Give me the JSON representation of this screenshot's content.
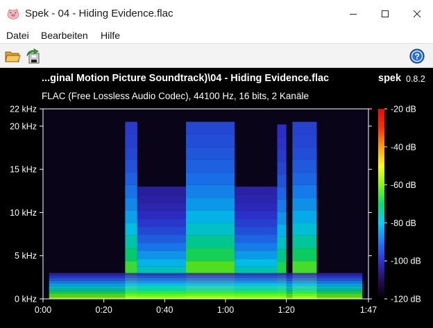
{
  "window": {
    "title": "Spek - 04 - Hiding Evidence.flac",
    "app_icon": "pig-icon"
  },
  "menu": {
    "items": [
      "Datei",
      "Bearbeiten",
      "Hilfe"
    ]
  },
  "toolbar": {
    "open_icon": "folder-open-icon",
    "save_icon": "save-export-icon",
    "help_icon": "help-icon"
  },
  "spectrogram": {
    "file_title": "...ginal Motion Picture Soundtrack)\\04 - Hiding Evidence.flac",
    "app_name": "spek",
    "version": "0.8.2",
    "file_info": "FLAC (Free Lossless Audio Codec), 44100 Hz, 16 bits, 2 Kanäle"
  },
  "chart_data": {
    "type": "heatmap",
    "title": "...ginal Motion Picture Soundtrack)\\04 - Hiding Evidence.flac",
    "subtitle": "FLAC (Free Lossless Audio Codec), 44100 Hz, 16 bits, 2 Kanäle",
    "x_ticks": [
      "0:00",
      "0:20",
      "0:40",
      "1:00",
      "1:20",
      "1:47"
    ],
    "x_tick_seconds": [
      0,
      20,
      40,
      60,
      80,
      107
    ],
    "x_range": [
      0,
      107
    ],
    "y_ticks": [
      "0 kHz",
      "5 kHz",
      "10 kHz",
      "15 kHz",
      "20 kHz",
      "22 kHz"
    ],
    "y_tick_khz": [
      0,
      5,
      10,
      15,
      20,
      22
    ],
    "y_range": [
      0,
      22
    ],
    "colorbar_ticks": [
      "-20 dB",
      "-40 dB",
      "-60 dB",
      "-80 dB",
      "-100 dB",
      "-120 dB"
    ],
    "colorbar_db": [
      -20,
      -40,
      -60,
      -80,
      -100,
      -120
    ],
    "colorbar_range": [
      -120,
      -20
    ],
    "colormap": [
      "#000000",
      "#2a0a5a",
      "#3030d8",
      "#1a7cff",
      "#00d0ff",
      "#00e070",
      "#80ff00",
      "#ffff00",
      "#ffa000",
      "#ff3000",
      "#ff0000"
    ],
    "loud_regions": [
      {
        "t_start": 27,
        "t_end": 31,
        "max_khz": 20.5,
        "level_db": -98
      },
      {
        "t_start": 31,
        "t_end": 47,
        "max_khz": 13,
        "level_db": -104
      },
      {
        "t_start": 47,
        "t_end": 63,
        "max_khz": 20.5,
        "level_db": -96
      },
      {
        "t_start": 63,
        "t_end": 77,
        "max_khz": 13,
        "level_db": -103
      },
      {
        "t_start": 77,
        "t_end": 80,
        "max_khz": 20.2,
        "level_db": -100
      },
      {
        "t_start": 82,
        "t_end": 90,
        "max_khz": 20.5,
        "level_db": -97
      }
    ]
  }
}
